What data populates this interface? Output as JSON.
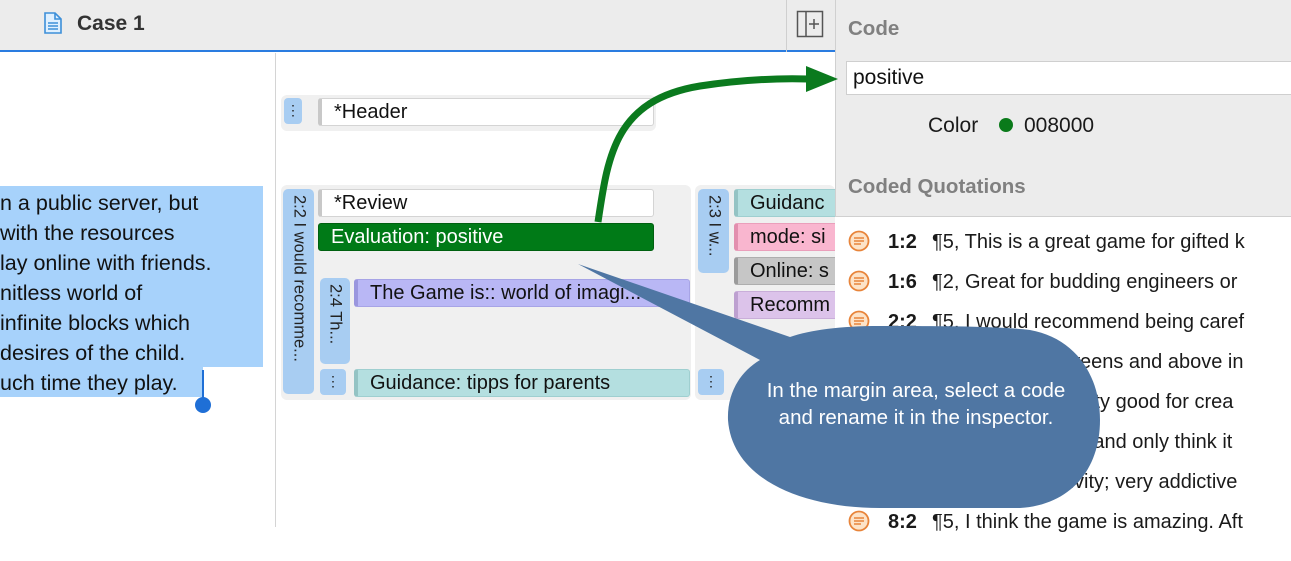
{
  "tab": {
    "title": "Case 1"
  },
  "document": {
    "lines": [
      "n a public server, but",
      " with the resources",
      "lay online with friends.",
      "nitless world of",
      " infinite blocks which",
      "desires of the child.",
      "uch time they play."
    ]
  },
  "margin": {
    "header_handle": "⋮",
    "header_chip": "*Header",
    "quote_22_label": "2:2 I would recomme...",
    "review_chip": "*Review",
    "evaluation_chip": "Evaluation: positive",
    "quote_24_label": "2:4 Th...",
    "game_chip": "The Game is:: world of imagi...",
    "lower_handle": "⋮",
    "guidance_chip": "Guidance: tipps for parents",
    "quote_23_label": "2:3 I w...",
    "guidance2_chip": "Guidanc",
    "mode_chip": "mode: si",
    "online_chip": "Online: s",
    "recomm_chip": "Recomm",
    "right_handle": "⋮"
  },
  "inspector": {
    "code_heading": "Code",
    "code_value": "positive",
    "color_label": "Color",
    "color_value": "008000",
    "quotations_heading": "Coded Quotations",
    "quotations": [
      {
        "ref": "1:2",
        "text": "¶5, This is a great game for gifted k"
      },
      {
        "ref": "1:6",
        "text": "¶2, Great for budding engineers or"
      },
      {
        "ref": "2:2",
        "text": "¶5, I would recommend being caref"
      },
      {
        "ref": "",
        "text": "tweens and above in"
      },
      {
        "ref": "",
        "text": "pretty good for crea"
      },
      {
        "ref": "",
        "text": "me and only think it"
      },
      {
        "ref": "",
        "text": "tivity; very addictive"
      },
      {
        "ref": "8:2",
        "text": "¶5, I think the game is amazing. Aft"
      }
    ]
  },
  "callout": {
    "text": "In the margin area, select a code and rename it in the inspector."
  },
  "colors": {
    "accent": "#2a7ce0",
    "code_green": "#008000",
    "callout_blue": "#4f76a3",
    "arrow_green": "#0a7a1a"
  }
}
